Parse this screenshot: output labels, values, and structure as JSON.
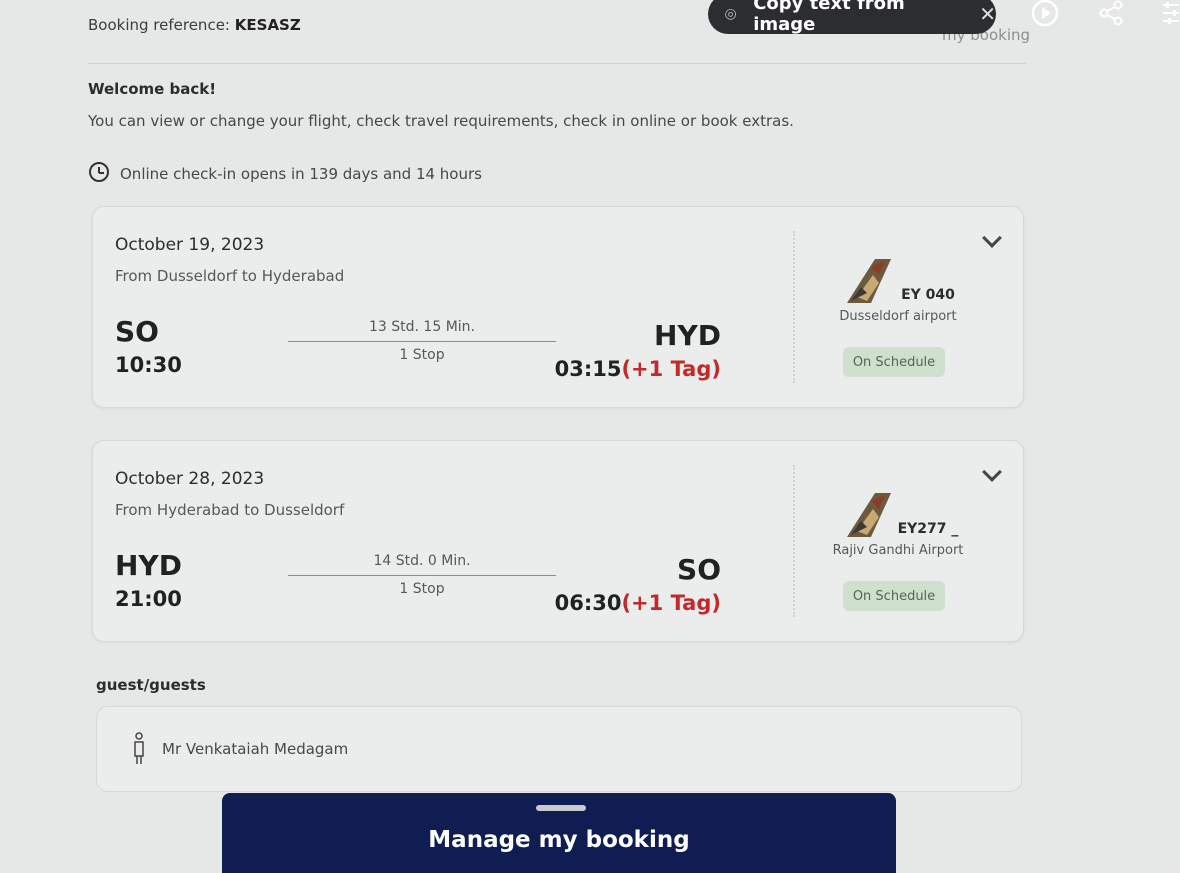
{
  "header": {
    "booking_ref_label": "Booking reference:",
    "booking_ref_value": "KESASZ",
    "my_booking_link": "my booking"
  },
  "overlay": {
    "copy_text": "Copy text from image",
    "close_icon": "close-icon",
    "lens_icon": "lens-icon",
    "play_icon": "play-icon",
    "share_icon": "share-icon",
    "filter_icon": "filter-icon"
  },
  "welcome": {
    "title": "Welcome back!",
    "subtitle": "You can view or change your flight, check travel requirements, check in online or book extras."
  },
  "checkin": {
    "text": "Online check-in opens in 139 days and 14 hours"
  },
  "flights": [
    {
      "date": "October 19, 2023",
      "route": "From Dusseldorf to Hyderabad",
      "from_code": "SO",
      "from_time": "10:30",
      "duration": "13 Std. 15 Min.",
      "stops": "1 Stop",
      "to_code": "HYD",
      "to_time": "03:15",
      "day_offset": "(+1 Tag)",
      "flight_no": "EY 040",
      "airport": "Dusseldorf airport",
      "status": "On Schedule"
    },
    {
      "date": "October 28, 2023",
      "route": "From Hyderabad to Dusseldorf",
      "from_code": "HYD",
      "from_time": "21:00",
      "duration": "14 Std. 0 Min.",
      "stops": "1 Stop",
      "to_code": "SO",
      "to_time": "06:30",
      "day_offset": "(+1 Tag)",
      "flight_no": "EY277 _",
      "airport": "Rajiv Gandhi Airport",
      "status": "On Schedule"
    }
  ],
  "guests": {
    "label": "guest/guests",
    "names": [
      "Mr Venkataiah Medagam"
    ]
  },
  "manage_button": {
    "label": "Manage my booking"
  },
  "colors": {
    "accent_navy": "#0f1d52",
    "status_green_bg": "#cfe0cf",
    "day_offset_red": "#c02a2a"
  }
}
